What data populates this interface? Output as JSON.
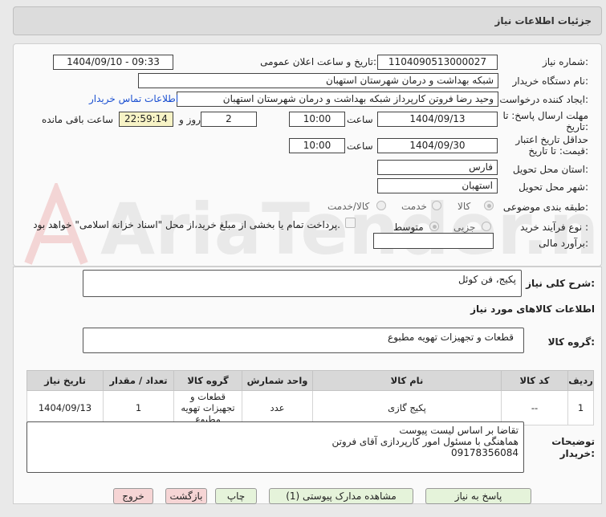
{
  "header": {
    "title": "جزئیات اطلاعات نیاز"
  },
  "form": {
    "need_number_label": "شماره نیاز:",
    "need_number": "1104090513000027",
    "announce_label": "تاریخ و ساعت اعلان عمومی:",
    "announce_value": "1404/09/10 - 09:33",
    "buyer_label": "نام دستگاه خریدار:",
    "buyer_value": "شبکه بهداشت و درمان شهرستان استهبان",
    "creator_label": "ایجاد کننده درخواست:",
    "creator_value": "وحید رضا فروتن کارپرداز شبکه بهداشت و درمان شهرستان استهبان",
    "contact_link": "اطلاعات تماس خریدار",
    "deadline_label": "مهلت ارسال پاسخ: تا تاریخ:",
    "deadline_date": "1404/09/13",
    "time_label": "ساعت",
    "deadline_time": "10:00",
    "days_value": "2",
    "days_label": "روز و",
    "remaining_value": "22:59:14",
    "remaining_label": "ساعت باقی مانده",
    "validity_label": "حداقل تاریخ اعتبار قیمت: تا تاریخ:",
    "validity_date": "1404/09/30",
    "validity_time": "10:00",
    "province_label": "استان محل تحویل:",
    "province_value": "فارس",
    "city_label": "شهر محل تحویل:",
    "city_value": "استهبان",
    "category_label": "طبقه بندی موضوعی:",
    "category_options": [
      "کالا",
      "خدمت",
      "کالا/خدمت"
    ],
    "process_label": "نوع فرآیند خرید :",
    "process_options": [
      "جزیی",
      "متوسط"
    ],
    "payment_note": "پرداخت تمام یا بخشی از مبلغ خرید،از محل \"اسناد خزانه اسلامی\" خواهد بود.",
    "estimate_label": "برآورد مالی:",
    "estimate_value": ""
  },
  "summary": {
    "label": "شرح کلی نیاز:",
    "value": "پکیج، فن کوئل",
    "items_heading": "اطلاعات کالاهای مورد نیاز",
    "group_label": "گروه کالا:",
    "group_value": "قطعات و تجهیزات تهویه مطبوع"
  },
  "table": {
    "headers": [
      "ردیف",
      "کد کالا",
      "نام کالا",
      "واحد شمارش",
      "گروه کالا",
      "تعداد / مقدار",
      "تاریخ نیاز"
    ],
    "rows": [
      [
        "1",
        "--",
        "پکیج گازی",
        "عدد",
        "قطعات و تجهیزات تهویه مطبوع",
        "1",
        "1404/09/13"
      ]
    ]
  },
  "notes": {
    "label": "توضیحات خریدار:",
    "lines": [
      "تقاضا بر اساس لیست پیوست",
      "هماهنگی با مسئول امور کارپردازی آقای فروتن",
      "09178356084"
    ]
  },
  "buttons": {
    "reply": "پاسخ به نیاز",
    "attachments": "مشاهده مدارک پیوستی (1)",
    "print": "چاپ",
    "back": "بازگشت",
    "exit": "خروج"
  },
  "colors": {
    "accent_link": "#1a4fd1",
    "button_green": "#e5f3da",
    "button_red": "#f6d5d5",
    "remaining_bg": "#f7f3c6"
  },
  "watermark_text": "AriaTender.neT"
}
